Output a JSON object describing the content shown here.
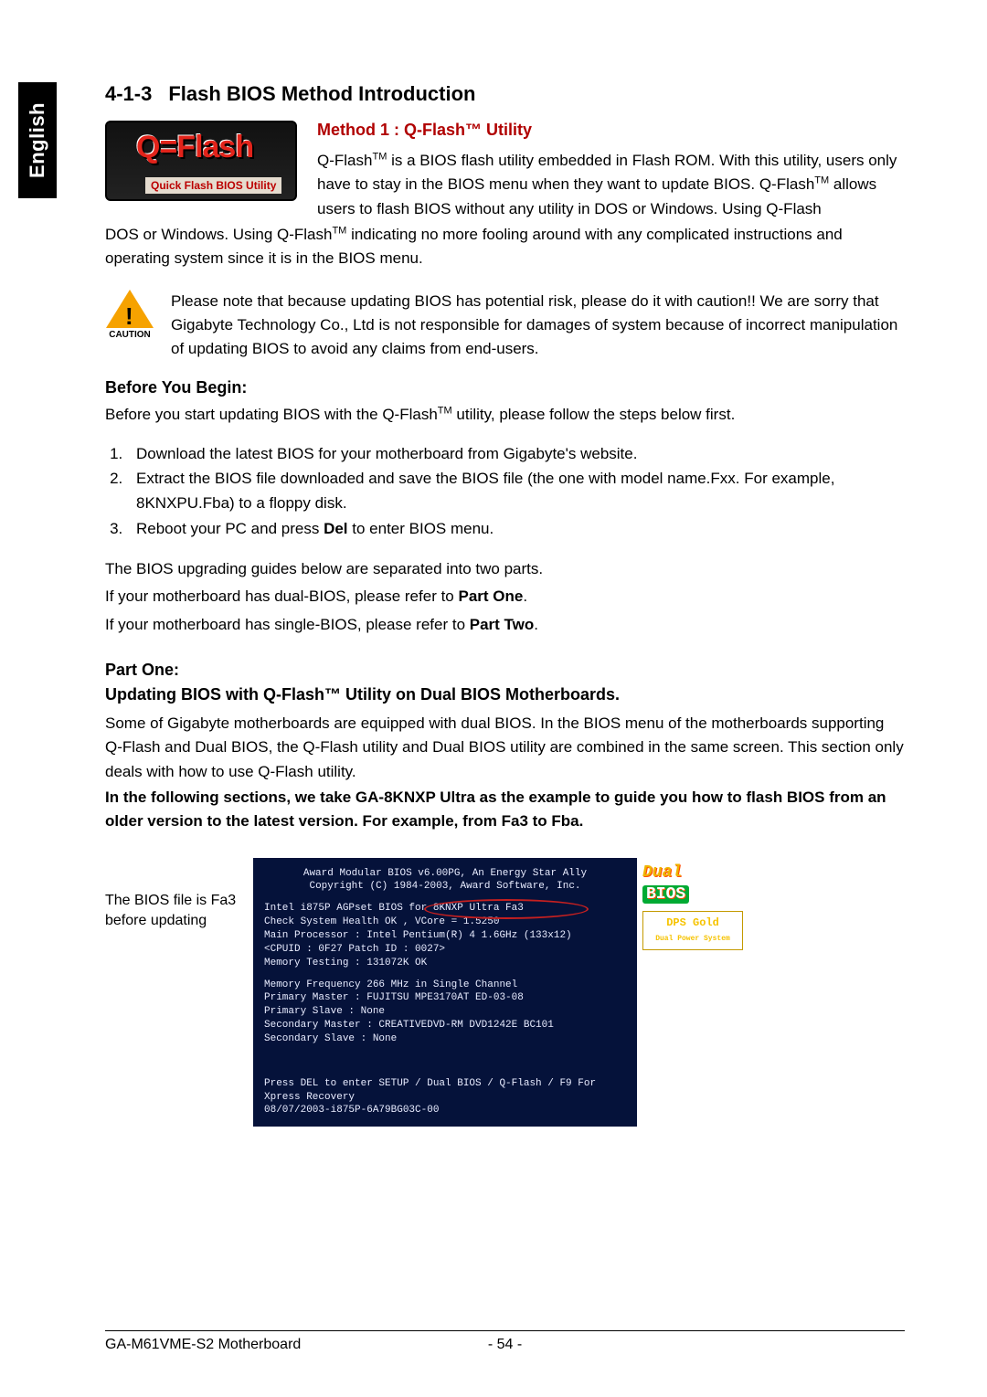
{
  "language_tab": "English",
  "section": {
    "number": "4-1-3",
    "title": "Flash BIOS Method Introduction"
  },
  "qflash_logo": {
    "main": "Q=Flash",
    "sub": "Quick Flash BIOS Utility"
  },
  "method1": {
    "heading": "Method 1 : Q-Flash™ Utility",
    "para1a": "Q-Flash",
    "para1b": " is a BIOS flash utility embedded in Flash ROM. With this utility, users only have to stay in the BIOS menu when they want to update BIOS. Q-Flash",
    "para1c": " allows users to flash BIOS without any utility in DOS or Windows. Using Q-Flash",
    "para1d": " indicating no more fooling around with any complicated instructions and operating system since it is in the BIOS menu."
  },
  "caution": {
    "label": "CAUTION",
    "text": "Please note that because updating BIOS has potential risk, please do it with caution!! We are sorry that Gigabyte Technology Co., Ltd is not responsible for damages of system because of incorrect manipulation of updating BIOS to avoid any claims from end-users."
  },
  "before": {
    "heading": "Before You Begin:",
    "intro_a": "Before you start updating BIOS with the Q-Flash",
    "intro_b": " utility, please follow the steps below first.",
    "steps": [
      "Download the latest BIOS for your motherboard from Gigabyte's website.",
      "Extract the BIOS file downloaded and save the BIOS file (the one with model name.Fxx. For example, 8KNXPU.Fba) to a floppy disk.",
      "Reboot your PC and press Del to enter BIOS menu."
    ],
    "after1": "The BIOS upgrading guides below are separated into two parts.",
    "after2a": "If your motherboard has dual-BIOS, please refer to ",
    "after2b": "Part One",
    "after2c": ".",
    "after3a": "If your motherboard has single-BIOS, please refer to ",
    "after3b": "Part Two",
    "after3c": "."
  },
  "partone": {
    "heading1": "Part One:",
    "heading2": "Updating BIOS with Q-Flash™ Utility on Dual BIOS Motherboards.",
    "p1": "Some of Gigabyte motherboards are equipped with dual BIOS. In the BIOS menu of the motherboards supporting Q-Flash and Dual BIOS, the Q-Flash utility and Dual BIOS utility are combined in the same screen. This section only deals with how to use Q-Flash utility.",
    "p2": "In the following sections, we take GA-8KNXP Ultra as the example to guide you how to flash BIOS from an older version to the latest version. For example, from Fa3 to Fba."
  },
  "shot_caption": "The BIOS file is Fa3 before updating",
  "bios": {
    "l1": "Award Modular BIOS v6.00PG, An Energy Star Ally",
    "l2": "Copyright  (C) 1984-2003, Award Software,  Inc.",
    "l3a": "Intel i875P AGPset BIOS for ",
    "l3b": "8KNXP Ultra Fa3",
    "l4": "Check System Health OK , VCore = 1.5250",
    "l5": "Main Processor :  Intel Pentium(R) 4  1.6GHz  (133x12)",
    "l6": "<CPUID : 0F27  Patch ID  : 0027>",
    "l7": "Memory Testing  : 131072K OK",
    "l8": "Memory Frequency 266 MHz in Single Channel",
    "l9": "Primary Master : FUJITSU MPE3170AT ED-03-08",
    "l10": "Primary Slave : None",
    "l11": "Secondary Master :  CREATIVEDVD-RM DVD1242E BC101",
    "l12": "Secondary Slave : None",
    "l13": "Press DEL to enter SETUP / Dual BIOS / Q-Flash / F9 For Xpress Recovery",
    "l14": "08/07/2003-i875P-6A79BG03C-00",
    "logo1a": "Dual",
    "logo1b": "BIOS",
    "logo2a": "DPS Gold",
    "logo2b": "Dual Power System"
  },
  "footer": {
    "model": "GA-M61VME-S2 Motherboard",
    "page": "- 54 -"
  }
}
